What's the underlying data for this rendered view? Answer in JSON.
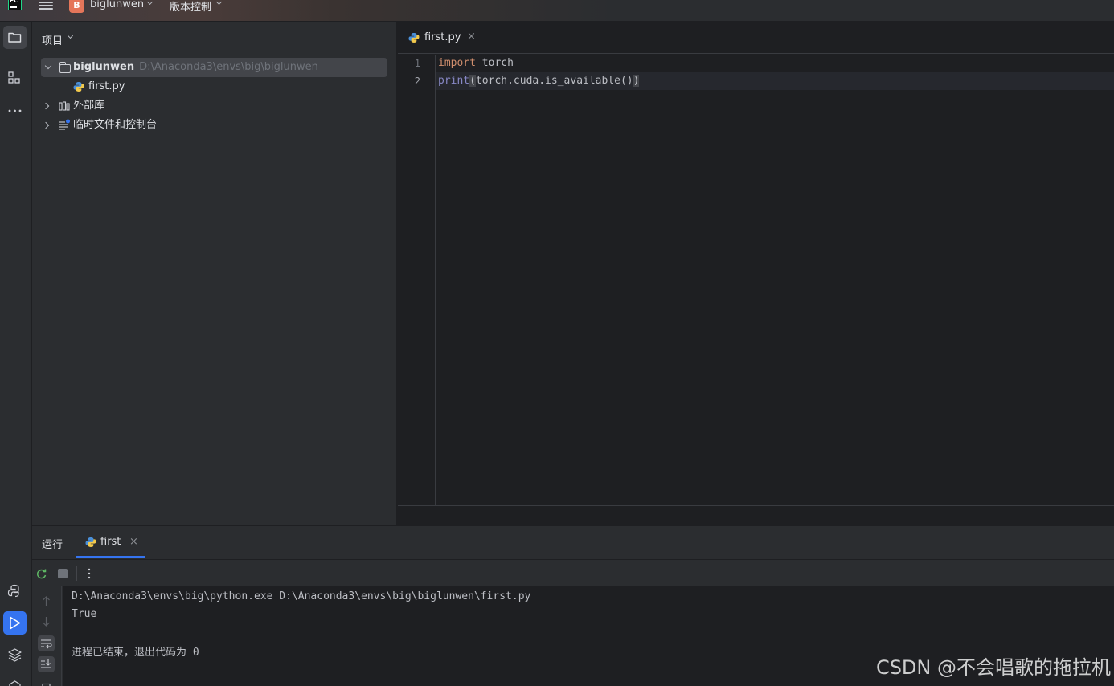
{
  "titlebar": {
    "app_logo_text": "PC",
    "project_badge": "B",
    "project_name": "biglunwen",
    "vcs_label": "版本控制"
  },
  "toolstrip": {
    "top_items": [
      "folder-icon",
      "structure-icon",
      "more-icon"
    ],
    "bottom_items": [
      "python-console-icon",
      "run-icon",
      "layers-icon",
      "services-icon"
    ]
  },
  "project_panel": {
    "title": "项目",
    "tree": [
      {
        "label": "biglunwen",
        "hint": "D:\\Anaconda3\\envs\\big\\biglunwen",
        "expanded": true
      },
      {
        "label": "first.py"
      },
      {
        "label": "外部库"
      },
      {
        "label": "临时文件和控制台"
      }
    ]
  },
  "editor": {
    "tab_label": "first.py",
    "tab_close": "×",
    "lines": [
      {
        "num": "1",
        "kw": "import",
        "rest": " torch"
      },
      {
        "num": "2",
        "fn": "print",
        "open": "(",
        "mid": "torch.cuda.is_available()",
        "close": ")"
      }
    ]
  },
  "run_panel": {
    "title": "运行",
    "tab_label": "first",
    "tab_close": "×",
    "console": [
      "D:\\Anaconda3\\envs\\big\\python.exe D:\\Anaconda3\\envs\\big\\biglunwen\\first.py",
      "True",
      "",
      "进程已结束，退出代码为 0"
    ]
  },
  "watermark": "CSDN @不会唱歌的拖拉机",
  "colors": {
    "accent": "#3574f0",
    "keyword": "#cf8e6d",
    "builtin": "#8888c6",
    "project_badge": "#e5765a"
  }
}
